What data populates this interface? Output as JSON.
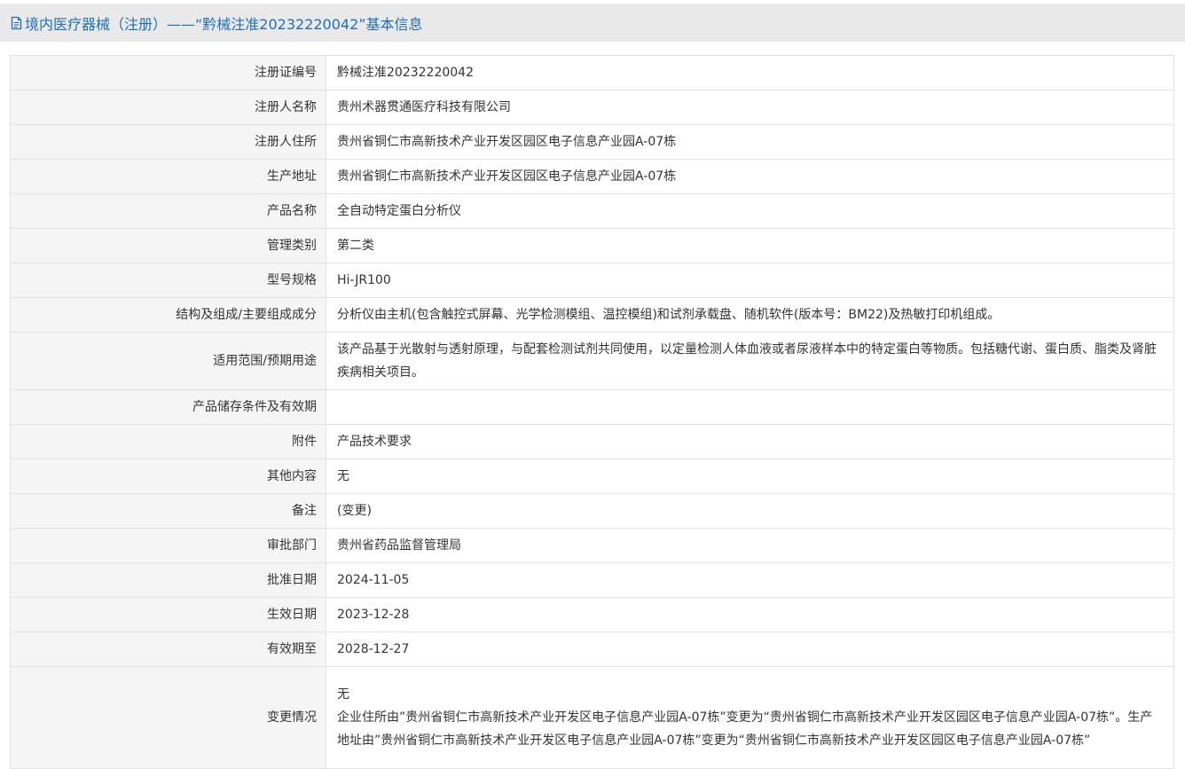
{
  "page_title": "境内医疗器械（注册）——“黔械注准20232220042”基本信息",
  "icons": {
    "title_icon": "document-icon"
  },
  "colors": {
    "title": "#1f6fb6",
    "title_bg": "#e9e9e9",
    "label_bg": "#f5f5f5",
    "border": "#e3e3e3"
  },
  "rows": [
    {
      "label": "注册证编号",
      "value": "黔械注准20232220042"
    },
    {
      "label": "注册人名称",
      "value": "贵州术器贯通医疗科技有限公司"
    },
    {
      "label": "注册人住所",
      "value": "贵州省铜仁市高新技术产业开发区园区电子信息产业园A-07栋"
    },
    {
      "label": "生产地址",
      "value": "贵州省铜仁市高新技术产业开发区园区电子信息产业园A-07栋"
    },
    {
      "label": "产品名称",
      "value": "全自动特定蛋白分析仪"
    },
    {
      "label": "管理类别",
      "value": "第二类"
    },
    {
      "label": "型号规格",
      "value": "Hi-JR100"
    },
    {
      "label": "结构及组成/主要组成成分",
      "value": "分析仪由主机(包含触控式屏幕、光学检测模组、温控模组)和试剂承载盘、随机软件(版本号：BM22)及热敏打印机组成。"
    },
    {
      "label": "适用范围/预期用途",
      "value": "该产品基于光散射与透射原理，与配套检测试剂共同使用，以定量检测人体血液或者尿液样本中的特定蛋白等物质。包括糖代谢、蛋白质、脂类及肾脏疾病相关项目。"
    },
    {
      "label": "产品储存条件及有效期",
      "value": ""
    },
    {
      "label": "附件",
      "value": "产品技术要求"
    },
    {
      "label": "其他内容",
      "value": "无"
    },
    {
      "label": "备注",
      "value": "(变更)"
    },
    {
      "label": "审批部门",
      "value": "贵州省药品监督管理局"
    },
    {
      "label": "批准日期",
      "value": "2024-11-05"
    },
    {
      "label": "生效日期",
      "value": "2023-12-28"
    },
    {
      "label": "有效期至",
      "value": "2028-12-27"
    },
    {
      "label": "变更情况",
      "value_line1": "无",
      "value_line2": "企业住所由”贵州省铜仁市高新技术产业开发区电子信息产业园A-07栋”变更为“贵州省铜仁市高新技术产业开发区园区电子信息产业园A-07栋”。生产地址由”贵州省铜仁市高新技术产业开发区电子信息产业园A-07栋”变更为“贵州省铜仁市高新技术产业开发区园区电子信息产业园A-07栋”"
    }
  ]
}
